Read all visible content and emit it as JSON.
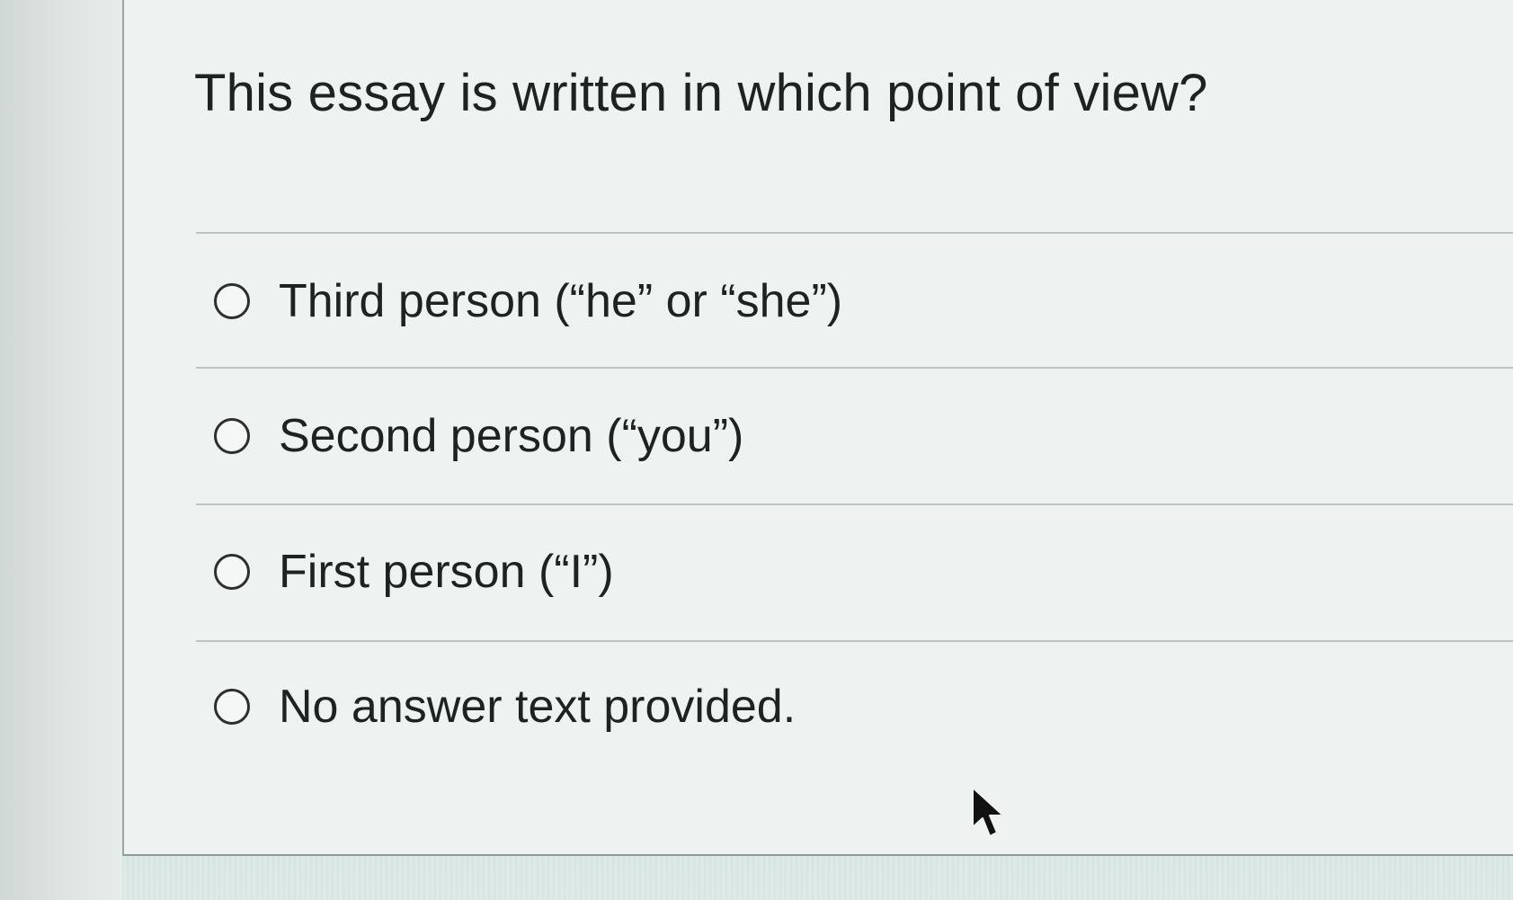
{
  "question": {
    "text": "This essay is written in which point of view?"
  },
  "options": [
    {
      "label": "Third person (“he” or “she”)",
      "selected": false
    },
    {
      "label": "Second person (“you”)",
      "selected": false
    },
    {
      "label": "First person (“I”)",
      "selected": false
    },
    {
      "label": "No answer text provided.",
      "selected": false
    }
  ],
  "icons": {
    "radio": "radio-unchecked-icon",
    "pointer": "mouse-pointer-icon"
  },
  "colors": {
    "text": "#1e2222",
    "card": "#eef3f1",
    "divider": "#b9c6c3"
  }
}
